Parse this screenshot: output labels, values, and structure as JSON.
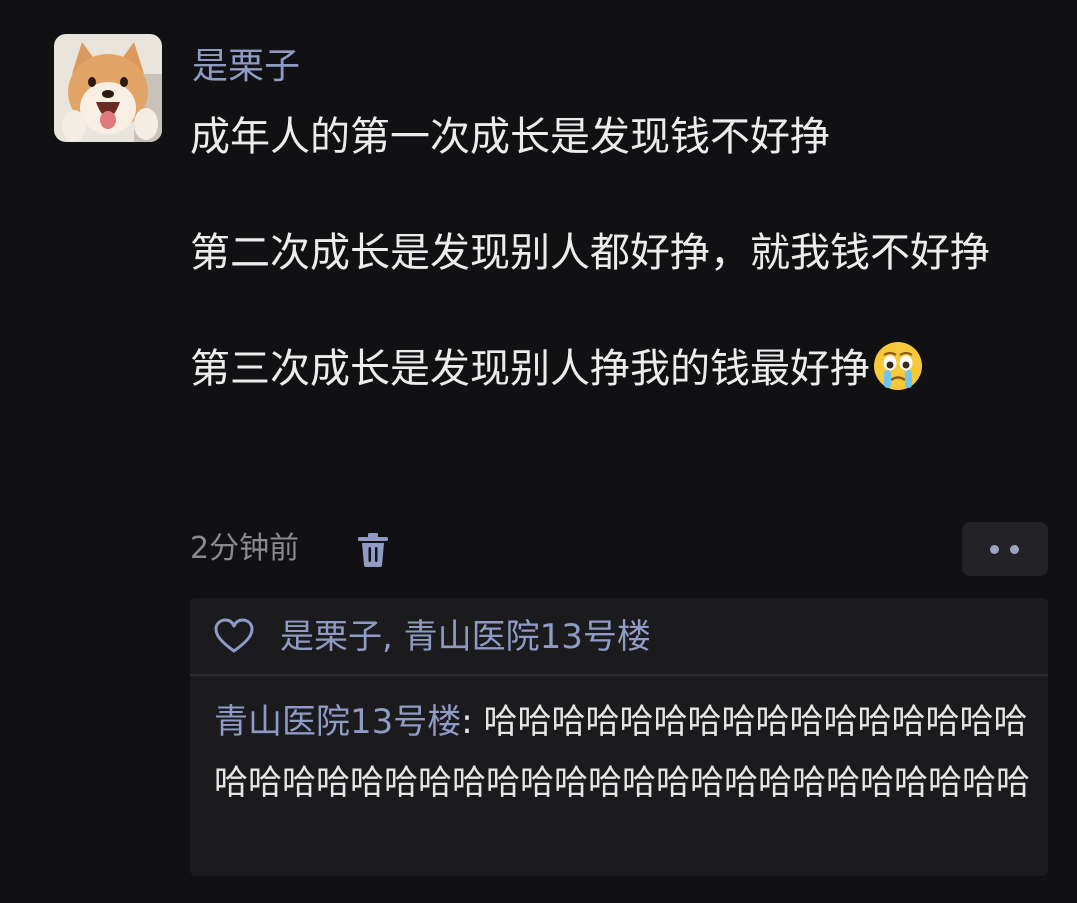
{
  "post": {
    "username": "是栗子",
    "avatar_icon": "shiba-dog-avatar",
    "lines": [
      "成年人的第一次成长是发现钱不好挣",
      "第二次成长是发现别人都好挣，就我钱不好挣",
      "第三次成长是发现别人挣我的钱最好挣"
    ],
    "emoji": "crying-face-emoji",
    "timestamp": "2分钟前",
    "delete_icon": "trash-icon",
    "more_icon": "more-dots-icon"
  },
  "likes": {
    "icon": "heart-icon",
    "names": "是栗子, 青山医院13号楼"
  },
  "comment": {
    "author": "青山医院13号楼",
    "separator": ": ",
    "text": "哈哈哈哈哈哈哈哈哈哈哈哈哈哈哈哈哈哈哈哈哈哈哈哈哈哈哈哈哈哈哈哈哈哈哈哈哈哈哈哈"
  },
  "colors": {
    "background": "#111113",
    "name_link": "#8f9bc4",
    "text": "#ececec",
    "muted": "#8a8a8e",
    "reply_bg": "#1b1b1e"
  }
}
